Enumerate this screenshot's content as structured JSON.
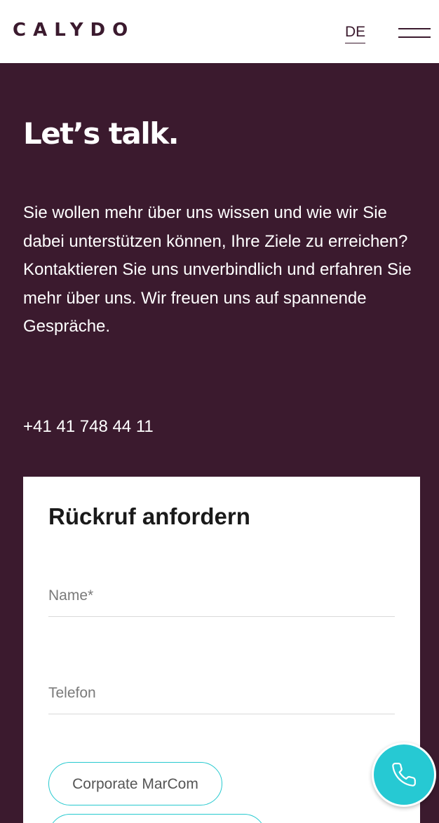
{
  "header": {
    "logo": "CALYDO",
    "language": "DE",
    "menu_icon": "hamburger-menu-icon"
  },
  "hero": {
    "title": "Let’s talk.",
    "intro": "Sie wollen mehr über uns wissen und wie wir Sie dabei unterstützen können, Ihre Ziele zu erreichen? Kontaktieren Sie uns unverbindlich und erfahren Sie mehr über uns. Wir freuen uns auf spannende Gespräche.",
    "phone": "+41 41 748 44 11"
  },
  "form": {
    "title": "Rückruf anfordern",
    "name_placeholder": "Name*",
    "name_value": "",
    "phone_placeholder": "Telefon",
    "phone_value": "",
    "topics": [
      {
        "label": "Corporate MarCom"
      },
      {
        "label": ""
      }
    ]
  },
  "fab": {
    "icon": "phone-icon"
  },
  "colors": {
    "brand": "#3b1a2e",
    "accent": "#26c9d3",
    "background": "#ffffff"
  }
}
